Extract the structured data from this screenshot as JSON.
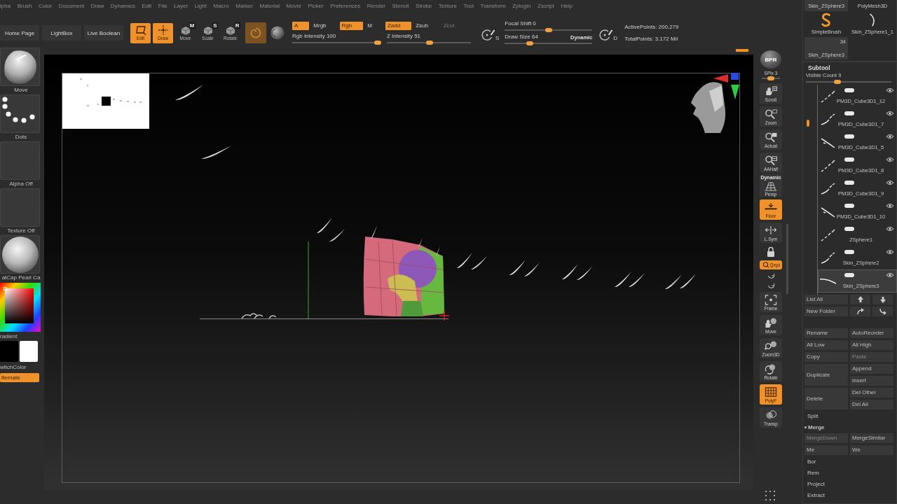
{
  "menu_bar": {
    "items": [
      "lpha",
      "Brush",
      "Color",
      "Document",
      "Draw",
      "Dynamics",
      "Edit",
      "File",
      "Layer",
      "Light",
      "Macro",
      "Marker",
      "Material",
      "Movie",
      "Picker",
      "Preferences",
      "Render",
      "Stencil",
      "Stroke",
      "Texture",
      "Tool",
      "Transform",
      "Zplugin",
      "Zscript",
      "Help"
    ]
  },
  "top_bar": {
    "nav_buttons": [
      "Home Page",
      "LightBox",
      "Live Boolean"
    ],
    "mode_buttons": [
      {
        "kind": "edit",
        "label": "Edit",
        "selected": true
      },
      {
        "kind": "draw",
        "label": "Draw",
        "selected": true
      },
      {
        "kind": "move",
        "key": "M",
        "label": "Move",
        "selected": false
      },
      {
        "kind": "scale",
        "key": "S",
        "label": "Scale",
        "selected": false
      },
      {
        "kind": "rotate",
        "key": "R",
        "label": "Rotate",
        "selected": false
      }
    ],
    "swirl_toggle": {
      "on": true
    },
    "channels": [
      {
        "label": "A",
        "on": true,
        "disabled": false
      },
      {
        "label": "Mrgb",
        "on": false,
        "disabled": false
      },
      {
        "label": "Rgb",
        "on": true,
        "disabled": false
      },
      {
        "label": "M",
        "on": false,
        "disabled": false
      },
      {
        "label": "Zadd",
        "on": true,
        "disabled": false
      },
      {
        "label": "Zsub",
        "on": false,
        "disabled": false
      },
      {
        "label": "Zcut",
        "on": false,
        "disabled": true
      }
    ],
    "intensity_sliders": [
      {
        "label": "Rgb Intensity 100",
        "level": 1
      },
      {
        "label": "Z Intensity 51",
        "level": 0.51
      }
    ],
    "focal_button": {
      "letter": "S"
    },
    "brush_sliders": [
      {
        "label": "Focal Shift 0",
        "level": 0.5
      },
      {
        "label": "Draw Size 64",
        "level": 0.27
      }
    ],
    "dynamic": "Dynamic",
    "points_button": {
      "letter": "D"
    },
    "stats": [
      "ActivePoints: 200,279",
      "TotalPoints: 3.172 Mil"
    ]
  },
  "left_shelf": {
    "slots": [
      {
        "kind": "brush",
        "label": "Move"
      },
      {
        "kind": "stroke",
        "label": "Dots"
      },
      {
        "kind": "alpha",
        "label": "Alpha Off"
      },
      {
        "kind": "texture",
        "label": "Texture Off"
      },
      {
        "kind": "material",
        "label": "atCap Pearl Ca"
      }
    ],
    "gradient": "radient",
    "swatches": [
      {
        "color": "#000000"
      },
      {
        "color": "#ffffff"
      }
    ],
    "switch_color": "witchColor",
    "alternate": {
      "label": "lternate",
      "on": true
    }
  },
  "right_shelf": {
    "bpr": "BPR",
    "spix": {
      "label": "SPix 3",
      "level": 0.5
    },
    "buttons": [
      {
        "kind": "scroll",
        "label": "Scroll",
        "on": false
      },
      {
        "kind": "zoom",
        "label": "Zoom",
        "on": false
      },
      {
        "kind": "actual",
        "label": "Actual",
        "on": false
      },
      {
        "kind": "aahalf",
        "label": "AAHalf",
        "on": false
      },
      {
        "kind": "persp",
        "label": "Persp",
        "caption": "Dynamic",
        "on": false
      },
      {
        "kind": "floor",
        "label": "Floor",
        "on": true
      },
      {
        "kind": "lsym",
        "label": "L.Sym",
        "on": false
      },
      {
        "kind": "lock",
        "on": false
      },
      {
        "kind": "qxyz",
        "label": "Qxyz",
        "on": true
      },
      {
        "kind": "roty",
        "on": false
      },
      {
        "kind": "roty",
        "on": false
      },
      {
        "kind": "frame",
        "label": "Frame",
        "on": false
      },
      {
        "kind": "move",
        "label": "Move",
        "on": false
      },
      {
        "kind": "zoom3d",
        "label": "Zoom3D",
        "on": false
      },
      {
        "kind": "rotate",
        "label": "Rotate",
        "on": false
      },
      {
        "kind": "polyf",
        "label": "PolyF",
        "on": true
      },
      {
        "kind": "transp",
        "label": "Transp",
        "on": false
      },
      {
        "kind": "solo",
        "on": false
      }
    ]
  },
  "tool_palette": {
    "items": [
      {
        "kind": "plain",
        "label": "Skin_ZSphere3"
      },
      {
        "kind": "mesh",
        "label": "PolyMesh3D"
      },
      {
        "kind": "brush",
        "label": "SimpleBrush"
      },
      {
        "kind": "curve",
        "label": "Skin_ZSphere1_1"
      }
    ],
    "current": {
      "count": "34",
      "label": "Skin_ZSphere3"
    }
  },
  "subtool": {
    "title": "Subtool",
    "visible_count": {
      "label": "Visible Count 9",
      "level": 0.36
    },
    "items": [
      {
        "name": "PM3D_Cube3D1_12",
        "visible": true,
        "selected": false
      },
      {
        "name": "PM3D_Cube3D1_7",
        "visible": true,
        "selected": false
      },
      {
        "name": "PM3D_Cube3D1_5",
        "visible": true,
        "selected": false
      },
      {
        "name": "PM3D_Cube3D1_8",
        "visible": true,
        "selected": false
      },
      {
        "name": "PM3D_Cube3D1_9",
        "visible": true,
        "selected": false
      },
      {
        "name": "PM3D_Cube3D1_10",
        "visible": true,
        "selected": false
      },
      {
        "name": "ZSphere1",
        "visible": true,
        "selected": false
      },
      {
        "name": "Skin_ZSphere2",
        "visible": true,
        "selected": false
      },
      {
        "name": "Skin_ZSphere3",
        "visible": true,
        "selected": true
      }
    ],
    "list_all": "List All",
    "new_folder": "New Folder",
    "actions": [
      {
        "left": {
          "label": "Rename",
          "disabled": false
        },
        "right": [
          {
            "label": "AutoReorder",
            "disabled": false
          }
        ]
      },
      {
        "left": {
          "label": "All Low",
          "disabled": false
        },
        "right": [
          {
            "label": "All High",
            "disabled": false
          }
        ]
      },
      {
        "left": {
          "label": "Copy",
          "disabled": false
        },
        "right": [
          {
            "label": "Paste",
            "disabled": true
          }
        ]
      },
      {
        "left": {
          "label": "Duplicate",
          "disabled": false
        },
        "right": [
          {
            "label": "Append",
            "disabled": false
          },
          {
            "label": "Insert",
            "disabled": false
          }
        ]
      },
      {
        "left": {
          "label": "Delete",
          "disabled": false
        },
        "right": [
          {
            "label": "Del Other",
            "disabled": false
          },
          {
            "label": "Del All",
            "disabled": false
          }
        ]
      }
    ],
    "sections": [
      {
        "label": "Split",
        "expanded": false
      },
      {
        "label": "Merge",
        "expanded": true,
        "buttons": [
          {
            "label": "MergeDown",
            "disabled": true
          },
          {
            "label": "MergeSimilar",
            "disabled": false
          },
          {
            "label": "Me",
            "disabled": false
          },
          {
            "label": "We",
            "disabled": false
          }
        ]
      },
      {
        "label": "Bor",
        "expanded": false
      },
      {
        "label": "Rem",
        "expanded": false
      },
      {
        "label": "Project",
        "expanded": false
      },
      {
        "label": "Extract",
        "expanded": false
      }
    ]
  }
}
